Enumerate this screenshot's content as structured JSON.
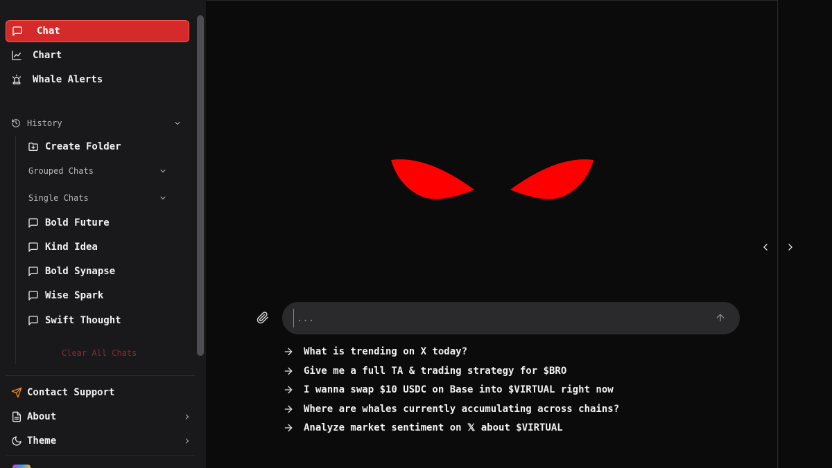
{
  "sidebar": {
    "nav": [
      {
        "label": "Chat",
        "icon": "message-square-icon",
        "active": true
      },
      {
        "label": "Chart",
        "icon": "line-chart-icon"
      },
      {
        "label": "Whale Alerts",
        "icon": "siren-icon"
      }
    ],
    "history": {
      "label": "History",
      "create_folder": "Create Folder",
      "grouped_chats_label": "Grouped Chats",
      "single_chats_label": "Single Chats",
      "chats": [
        "Bold Future",
        "Kind Idea",
        "Bold Synapse",
        "Wise Spark",
        "Swift Thought"
      ],
      "clear_all": "Clear All Chats"
    },
    "footer": {
      "contact_support": "Contact Support",
      "about": "About",
      "theme": "Theme"
    }
  },
  "composer": {
    "placeholder": "..."
  },
  "suggestions": [
    "What is trending on X today?",
    "Give me a full TA & trading strategy for $BRO",
    "I wanna swap $10 USDC on Base into $VIRTUAL right now",
    "Where are whales currently accumulating across chains?",
    "Analyze market sentiment on 𝕏 about $VIRTUAL"
  ],
  "colors": {
    "accent": "#d42a2a",
    "eyes": "#ff0000",
    "background": "#0b0b0c",
    "sidebar": "#19191b"
  }
}
